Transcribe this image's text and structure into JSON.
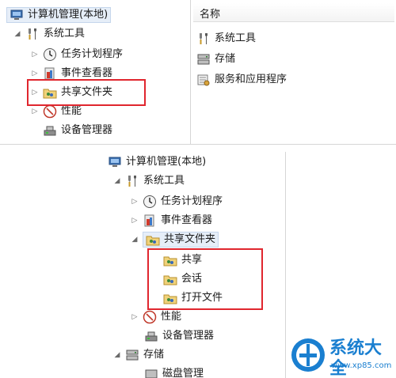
{
  "top_panel": {
    "root_label": "计算机管理(本地)",
    "tree": [
      {
        "label": "系统工具",
        "icon": "tools-icon"
      },
      {
        "label": "任务计划程序",
        "icon": "clock-icon"
      },
      {
        "label": "事件查看器",
        "icon": "event-viewer-icon"
      },
      {
        "label": "共享文件夹",
        "icon": "shared-folder-icon"
      },
      {
        "label": "性能",
        "icon": "performance-icon"
      },
      {
        "label": "设备管理器",
        "icon": "device-manager-icon"
      }
    ],
    "list_header": "名称",
    "list_items": [
      {
        "label": "系统工具",
        "icon": "tools-icon"
      },
      {
        "label": "存储",
        "icon": "storage-icon"
      },
      {
        "label": "服务和应用程序",
        "icon": "services-icon"
      }
    ]
  },
  "bottom_panel": {
    "root_label": "计算机管理(本地)",
    "tree": [
      {
        "label": "系统工具",
        "icon": "tools-icon"
      },
      {
        "label": "任务计划程序",
        "icon": "clock-icon"
      },
      {
        "label": "事件查看器",
        "icon": "event-viewer-icon"
      },
      {
        "label": "共享文件夹",
        "icon": "shared-folder-icon"
      },
      {
        "label": "共享",
        "icon": "share-icon"
      },
      {
        "label": "会话",
        "icon": "session-icon"
      },
      {
        "label": "打开文件",
        "icon": "open-files-icon"
      },
      {
        "label": "性能",
        "icon": "performance-icon"
      },
      {
        "label": "设备管理器",
        "icon": "device-manager-icon"
      },
      {
        "label": "存储",
        "icon": "storage-icon"
      },
      {
        "label": "磁盘管理",
        "icon": "disk-icon"
      }
    ]
  },
  "watermark": {
    "title": "系统大全",
    "url": "www.xp85.com"
  },
  "colors": {
    "highlight_box": "#e0262e",
    "selection_bg": "#e6eef8",
    "logo_blue": "#1a7fd0"
  }
}
